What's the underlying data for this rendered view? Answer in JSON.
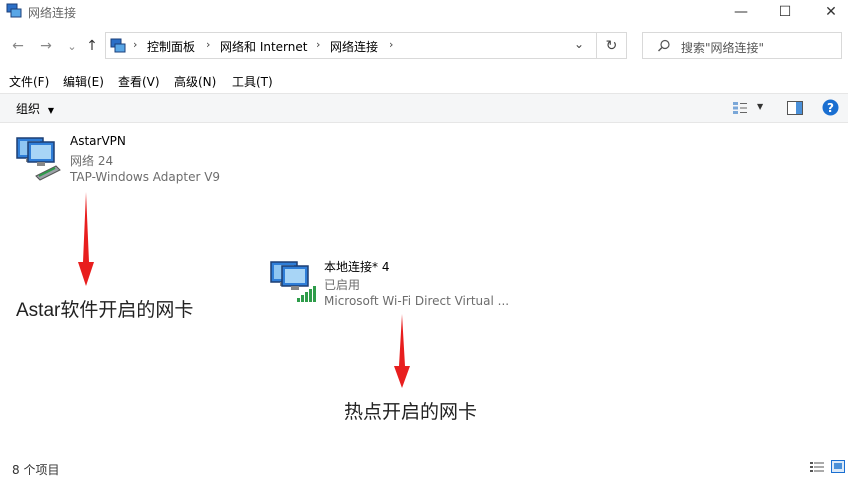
{
  "window": {
    "title": "网络连接",
    "minimize": "—",
    "maximize": "☐",
    "close": "✕"
  },
  "nav": {
    "back": "←",
    "forward": "→",
    "history": "⌄",
    "up": "↑",
    "breadcrumb": [
      "控制面板",
      "网络和 Internet",
      "网络连接"
    ],
    "refresh": "↻",
    "search_placeholder": "搜索\"网络连接\""
  },
  "menu": [
    "文件(F)",
    "编辑(E)",
    "查看(V)",
    "高级(N)",
    "工具(T)"
  ],
  "toolbar": {
    "organize": "组织"
  },
  "connections": [
    {
      "name": "AstarVPN",
      "status": "网络 24",
      "device": "TAP-Windows Adapter V9"
    },
    {
      "name": "本地连接* 4",
      "status": "已启用",
      "device": "Microsoft Wi-Fi Direct Virtual ..."
    }
  ],
  "annotations": {
    "vpn_label": "Astar软件开启的网卡",
    "hotspot_label": "热点开启的网卡",
    "arrow_color": "#e81e1e"
  },
  "statusbar": {
    "count": "8 个项目"
  },
  "colors": {
    "accent": "#1a6fd1",
    "toolbar_bg": "#f5f6f7"
  }
}
